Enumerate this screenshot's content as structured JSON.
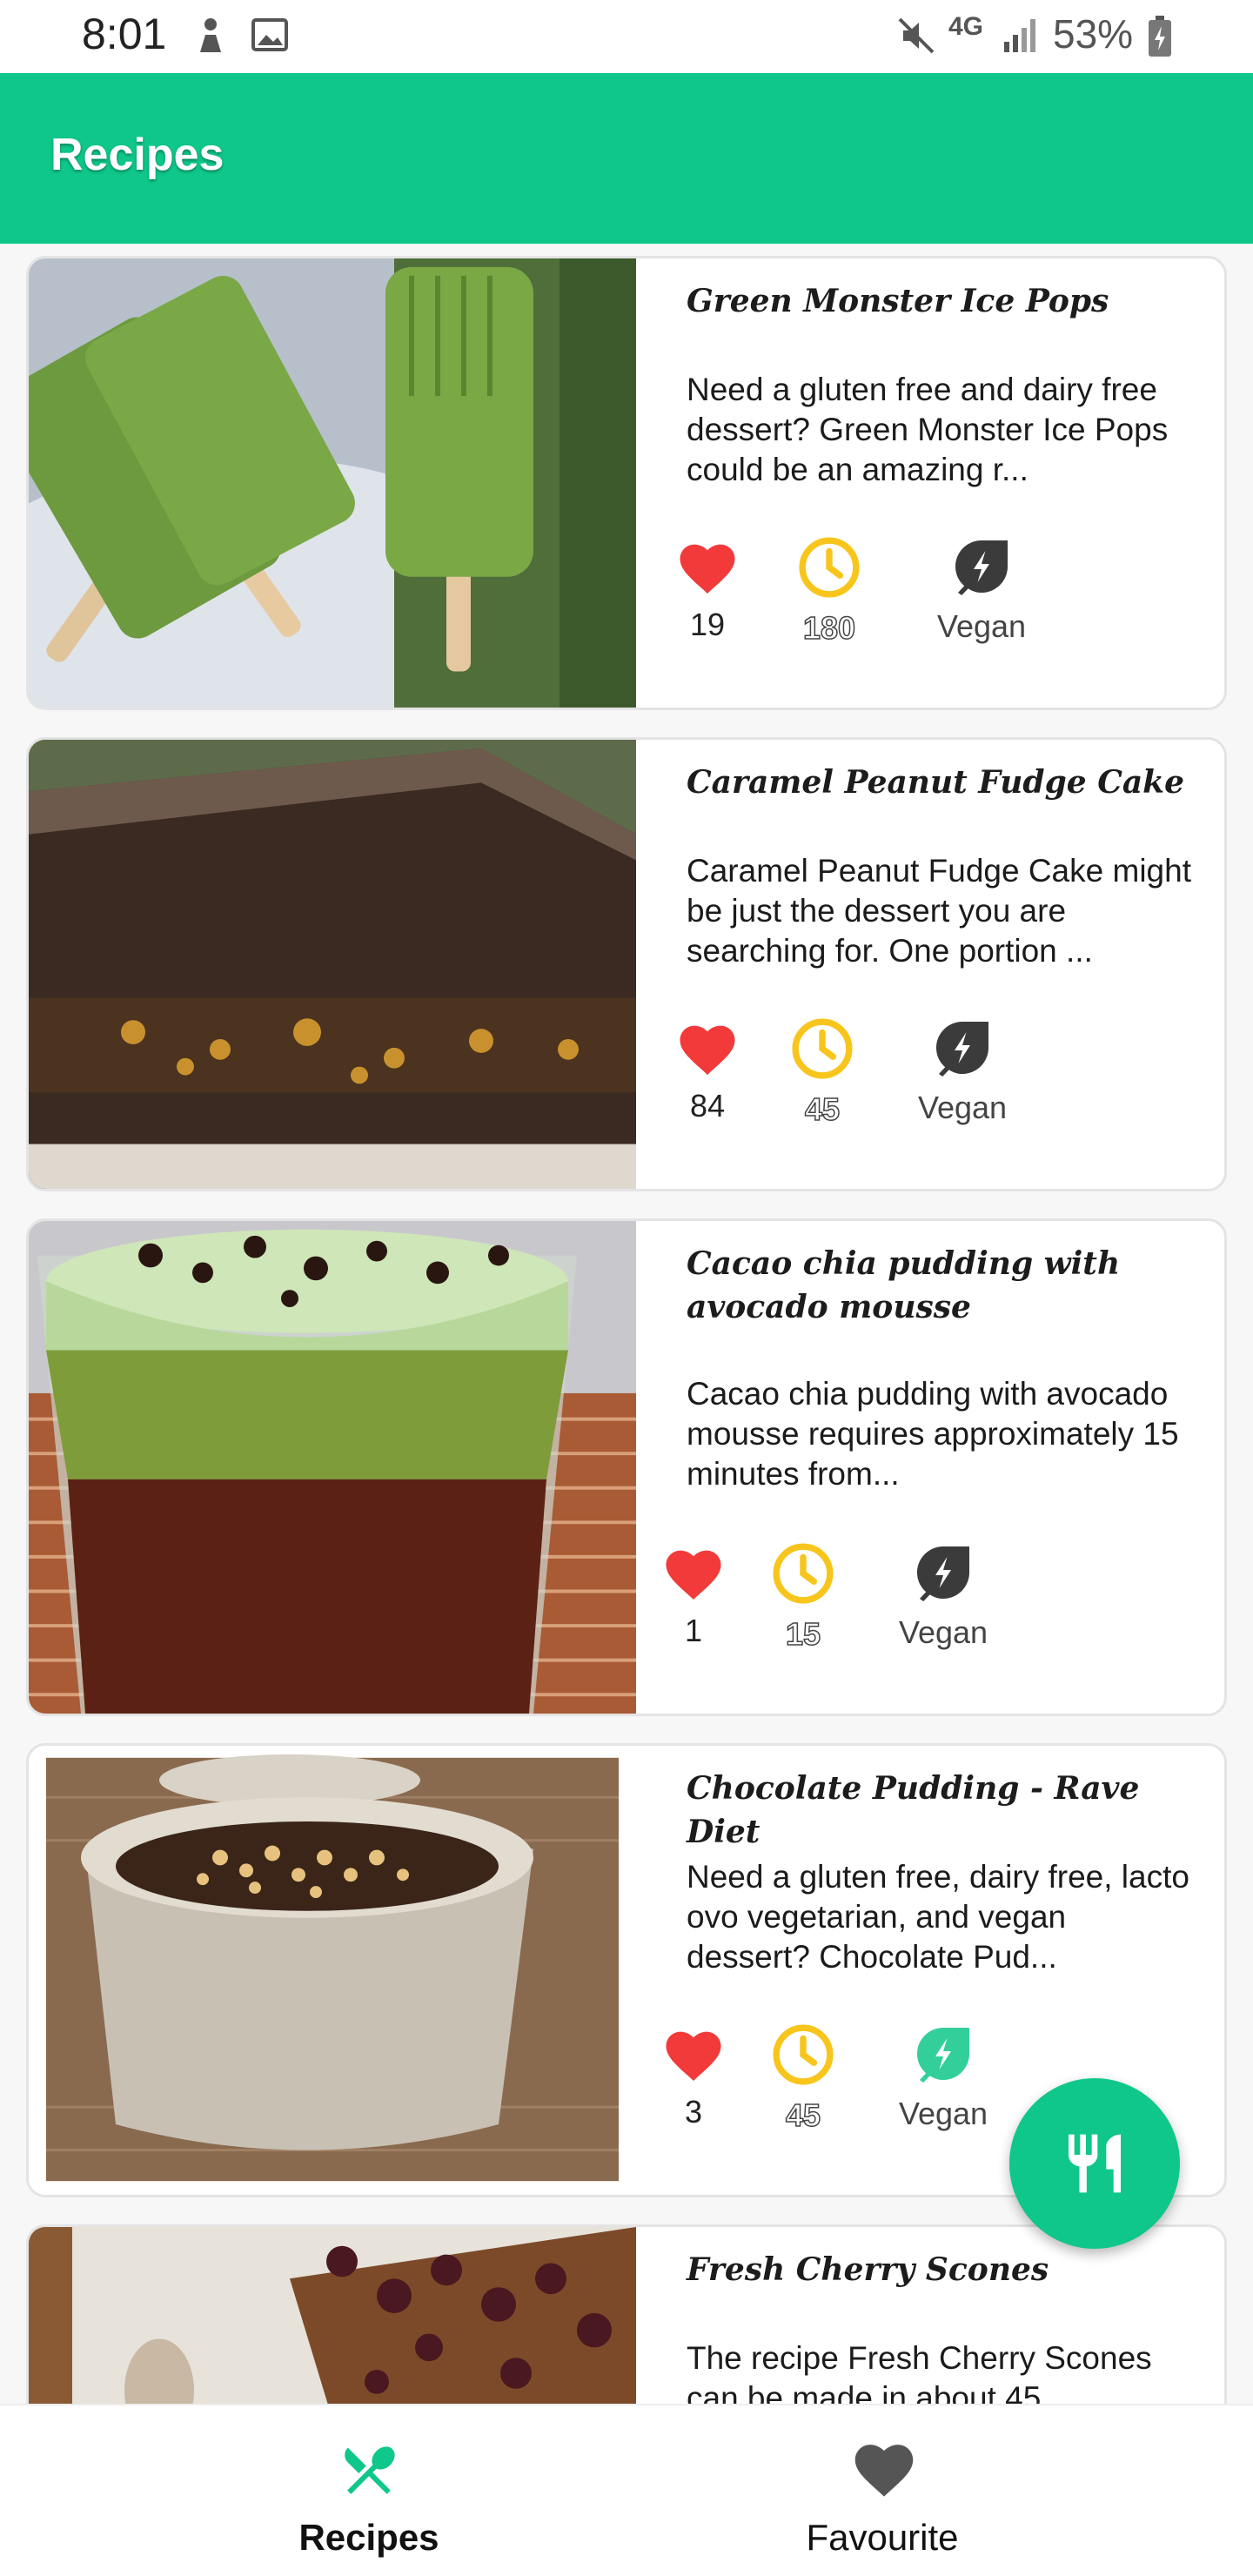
{
  "status_bar": {
    "time": "8:01",
    "network": "4G",
    "battery": "53%"
  },
  "app_bar": {
    "title": "Recipes"
  },
  "recipes": [
    {
      "title": "Green Monster Ice Pops",
      "description": "Need a gluten free and dairy free dessert? Green Monster Ice Pops could be an amazing r...",
      "likes": "19",
      "minutes": "180",
      "diet_label": "Vegan",
      "vegan_active": false
    },
    {
      "title": "Caramel Peanut Fudge Cake",
      "description": "Caramel Peanut Fudge Cake might be just the dessert you are searching for. One portion ...",
      "likes": "84",
      "minutes": "45",
      "diet_label": "Vegan",
      "vegan_active": false
    },
    {
      "title": "Cacao chia pudding with avocado mousse",
      "description": "Cacao chia pudding with avocado mousse requires approximately 15 minutes from...",
      "likes": "1",
      "minutes": "15",
      "diet_label": "Vegan",
      "vegan_active": false
    },
    {
      "title": "Chocolate Pudding - Rave Diet",
      "description": "Need a gluten free, dairy free, lacto ovo vegetarian, and vegan dessert? Chocolate Pud...",
      "likes": "3",
      "minutes": "45",
      "diet_label": "Vegan",
      "vegan_active": true
    },
    {
      "title": "Fresh Cherry Scones",
      "description": "The recipe Fresh Cherry Scones can be made in about 45",
      "likes": "",
      "minutes": "",
      "diet_label": "",
      "vegan_active": false
    }
  ],
  "fab": {
    "icon": "restaurant-icon"
  },
  "bottom_nav": {
    "items": [
      {
        "label": "Recipes",
        "icon": "fork-knife-icon",
        "active": true
      },
      {
        "label": "Favourite",
        "icon": "heart-icon",
        "active": false
      }
    ]
  },
  "colors": {
    "primary": "#0fc78a",
    "heart": "#f23a3a",
    "clock": "#f7c51c",
    "leaf_inactive": "#3b3b3b",
    "leaf_active": "#0fc78a"
  }
}
